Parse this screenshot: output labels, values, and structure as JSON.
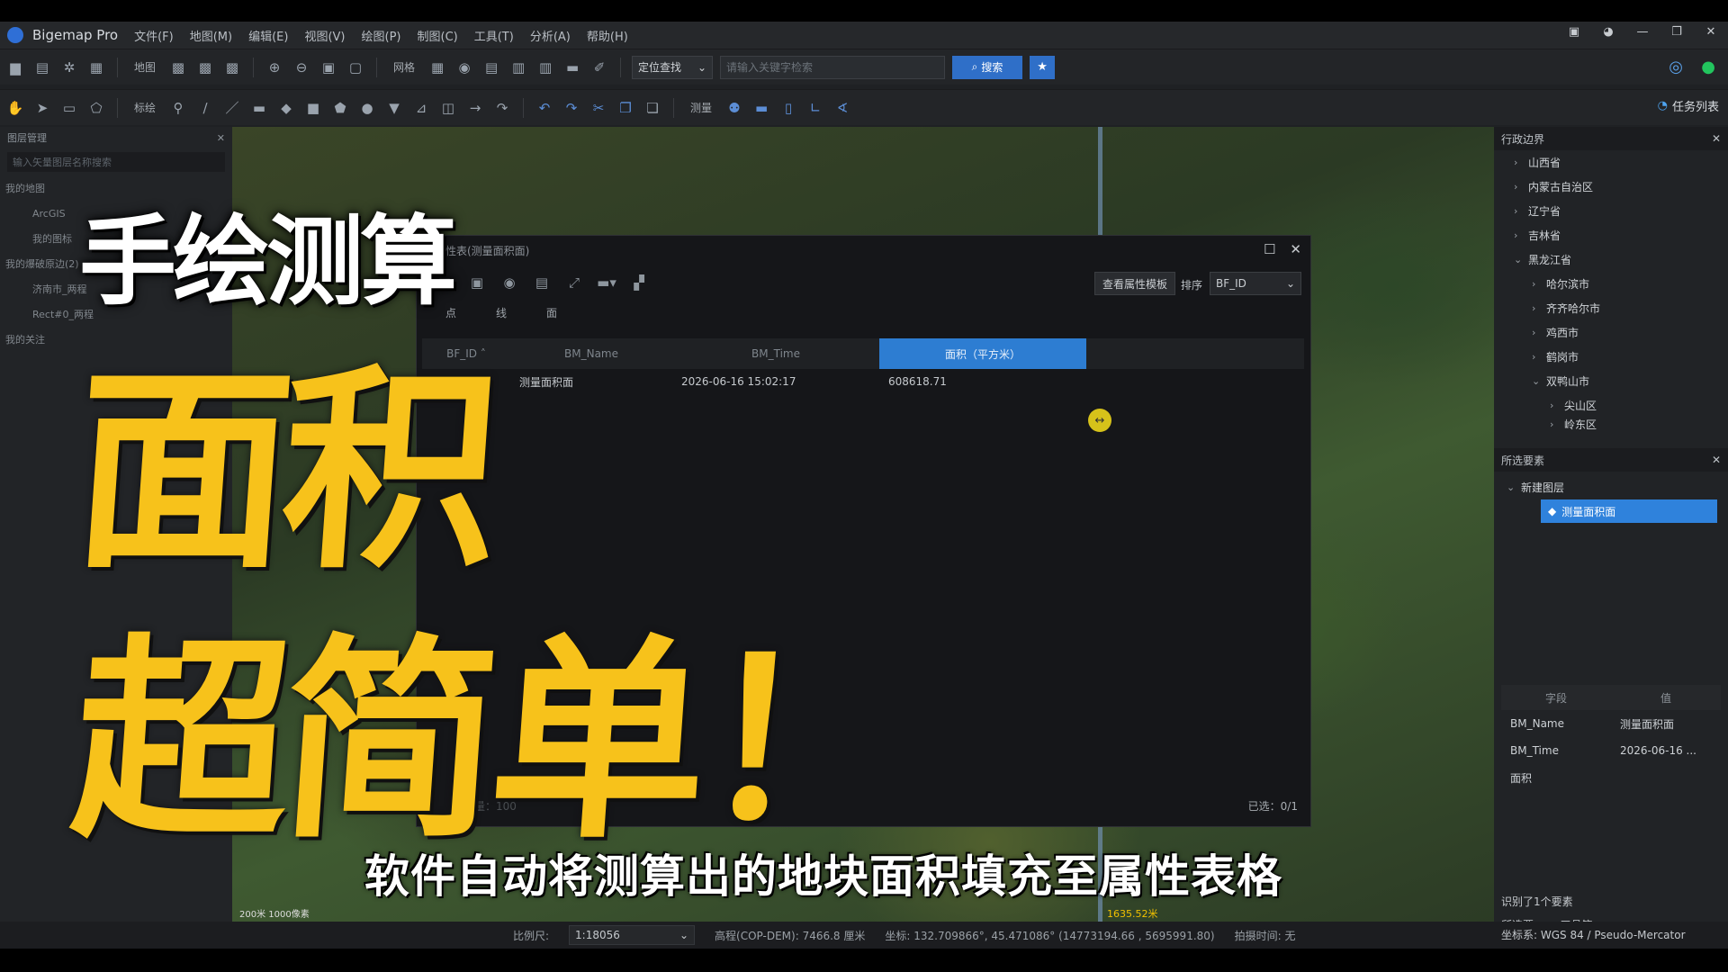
{
  "app": {
    "name": "Bigemap Pro"
  },
  "menu": [
    "文件(F)",
    "地图(M)",
    "编辑(E)",
    "视图(V)",
    "绘图(P)",
    "制图(C)",
    "工具(T)",
    "分析(A)",
    "帮助(H)"
  ],
  "toolbar": {
    "map_label": "地图",
    "grid_label": "网格",
    "locate_label": "定位查找",
    "search_placeholder": "请输入关键字检索",
    "search_button": "搜索",
    "annotate_label": "标绘",
    "measure_label": "测量",
    "task_list": "任务列表"
  },
  "left_panel": {
    "title": "图层管理",
    "search_placeholder": "输入矢量图层名称搜索",
    "items": [
      "我的地图",
      "ArcGIS",
      "我的图标",
      "我的爆破原边(2)",
      "济南市_两程",
      "Rect#0_两程",
      "我的关注"
    ]
  },
  "dialog": {
    "title": "属性表(测量面积面)",
    "template_button": "查看属性模板",
    "sort_label": "排序",
    "sort_value": "BF_ID",
    "tabs": [
      "点",
      "线",
      "面"
    ],
    "columns": [
      "BF_ID",
      "BM_Name",
      "BM_Time",
      "面积（平方米）"
    ],
    "rows": [
      {
        "id": "5",
        "name": "测量面积面",
        "time": "2026-06-16 15:02:17",
        "area": "608618.71"
      }
    ],
    "page_info": "页数量：100",
    "selected": "已选：0/1"
  },
  "right_panel": {
    "admin_title": "行政边界",
    "admin_items": [
      "山西省",
      "内蒙古自治区",
      "辽宁省",
      "吉林省",
      "黑龙江省",
      "哈尔滨市",
      "齐齐哈尔市",
      "鸡西市",
      "鹤岗市",
      "双鸭山市",
      "尖山区",
      "岭东区"
    ],
    "selected_title": "所选要素",
    "new_layer": "新建图层",
    "selected_item": "测量面积面",
    "attr_headers": [
      "字段",
      "值"
    ],
    "attrs": [
      {
        "k": "BM_Name",
        "v": "测量面积面"
      },
      {
        "k": "BM_Time",
        "v": "2026-06-16 ..."
      },
      {
        "k": "面积",
        "v": ""
      }
    ],
    "found": "识别了1个要素",
    "tabs": [
      "所选要...",
      "工具箱"
    ]
  },
  "map": {
    "scale_text": "200米\n1000像素",
    "distance": "1635.52米"
  },
  "status": {
    "scale_label": "比例尺:",
    "scale_value": "1:18056",
    "elevation": "高程(COP-DEM): 7466.8 厘米",
    "coords": "坐标: 132.709866°, 45.471086° (14773194.66 , 5695991.80)",
    "capture_time": "拍摄时间: 无",
    "crs": "坐标系: WGS 84 / Pseudo-Mercator"
  },
  "overlay": {
    "line1": "手绘测算",
    "line2": "面积",
    "line3": "超简单！",
    "subtitle": "软件自动将测算出的地块面积填充至属性表格",
    "yellow": "#f7c21b"
  }
}
